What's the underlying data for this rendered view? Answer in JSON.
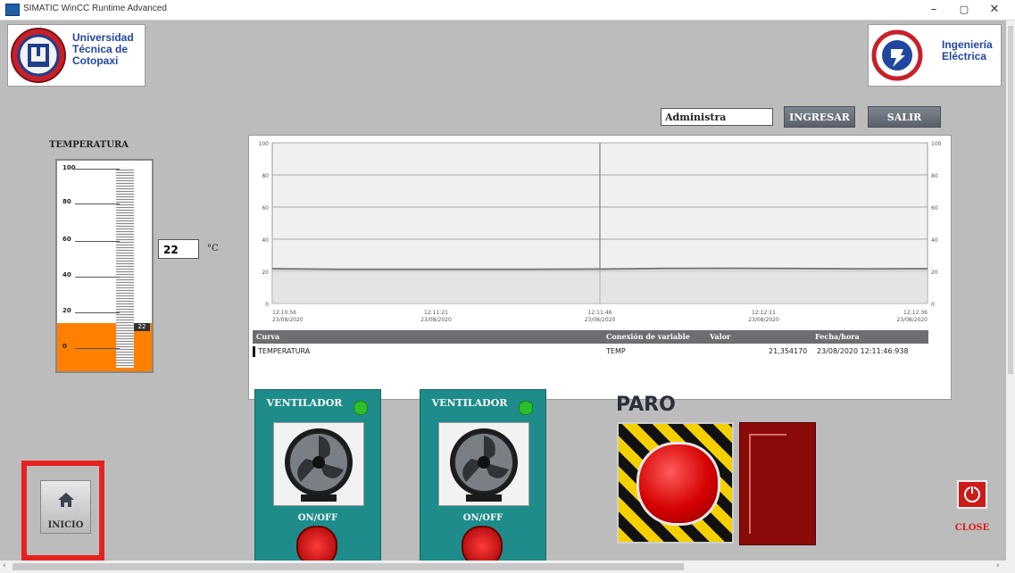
{
  "window": {
    "title": "SIMATIC WinCC Runtime Advanced",
    "minimize": "–",
    "maximize": "▢",
    "close": "✕"
  },
  "logos": {
    "left_text": [
      "Universidad",
      "Técnica de",
      "Cotopaxi"
    ],
    "right_text": [
      "Ingeniería",
      "Eléctrica"
    ]
  },
  "login": {
    "user_value": "Administra",
    "ingresar_label": "INGRESAR",
    "salir_label": "SALIR"
  },
  "temperature": {
    "label": "TEMPERATURA",
    "value": "22",
    "unit": "°C",
    "gauge_ticks": [
      "100",
      "80",
      "60",
      "40",
      "20",
      "0"
    ],
    "gauge_level_percent": 22,
    "fill_color": "#ff8000"
  },
  "chart_data": {
    "type": "line",
    "title": "",
    "xlabel": "",
    "ylabel": "",
    "ylim": [
      0,
      100
    ],
    "y_ticks": [
      "100",
      "80",
      "60",
      "40",
      "20",
      "0"
    ],
    "x_ticks": [
      {
        "time": "12:10:56",
        "date": "23/08/2020"
      },
      {
        "time": "12:11:21",
        "date": "23/08/2020"
      },
      {
        "time": "12:11:46",
        "date": "23/08/2020"
      },
      {
        "time": "12:12:11",
        "date": "23/08/2020"
      },
      {
        "time": "12:12:36",
        "date": "23/08/2020"
      }
    ],
    "series": [
      {
        "name": "TEMPERATURA",
        "x": [
          "12:10:56",
          "12:11:06",
          "12:11:16",
          "12:11:26",
          "12:11:36",
          "12:11:46",
          "12:11:56",
          "12:12:06",
          "12:12:16",
          "12:12:26",
          "12:12:36"
        ],
        "values": [
          21.6,
          21.3,
          21.3,
          21.3,
          21.3,
          21.4,
          21.8,
          21.9,
          21.7,
          21.5,
          21.6
        ]
      }
    ],
    "grid": true
  },
  "legend_table": {
    "headers": [
      "Curva",
      "Conexión de variable",
      "Valor",
      "Fecha/hora"
    ],
    "rows": [
      {
        "curva": "TEMPERATURA",
        "variable": "TEMP",
        "valor": "21,354170",
        "fecha": "23/08/2020 12:11:46:938"
      }
    ]
  },
  "fans": [
    {
      "title": "VENTILADOR",
      "onoff_label": "ON/OFF"
    },
    {
      "title": "VENTILADOR",
      "onoff_label": "ON/OFF"
    }
  ],
  "paro": {
    "label": "PARO"
  },
  "nav": {
    "inicio_label": "INICIO",
    "close_label": "CLOSE"
  },
  "colors": {
    "panel_teal": "#1e8c8a",
    "alarm_red": "#e52220",
    "indicator_dark_red": "#8a0a0a"
  }
}
